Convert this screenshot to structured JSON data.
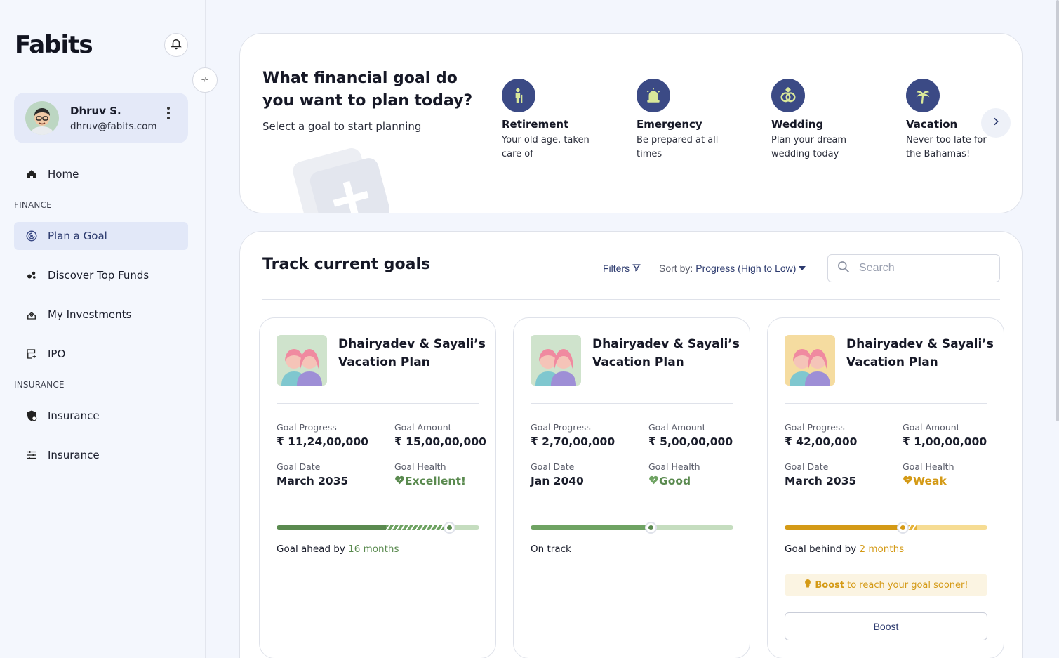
{
  "brand": {
    "logo": "Fabits"
  },
  "user": {
    "name": "Dhruv S.",
    "email": "dhruv@fabits.com"
  },
  "nav": {
    "home": "Home",
    "finance_label": "FINANCE",
    "plan_goal": "Plan a Goal",
    "discover": "Discover Top Funds",
    "investments": "My Investments",
    "ipo": "IPO",
    "insurance_label": "INSURANCE",
    "insurance1": "Insurance",
    "insurance2": "Insurance"
  },
  "banner": {
    "title": "What financial goal do you want to plan today?",
    "subtitle": "Select a goal to start planning",
    "options": [
      {
        "name": "Retirement",
        "desc": "Your old age, taken care of",
        "icon": "elder-icon"
      },
      {
        "name": "Emergency",
        "desc": "Be prepared at all times",
        "icon": "siren-icon"
      },
      {
        "name": "Wedding",
        "desc": "Plan your dream wedding today",
        "icon": "rings-icon"
      },
      {
        "name": "Vacation",
        "desc": "Never too late for the Bahamas!",
        "icon": "palm-tree-icon"
      }
    ]
  },
  "track": {
    "title": "Track current goals",
    "filters": "Filters",
    "sort_prefix": "Sort by:",
    "sort_value": "Progress (High to Low)",
    "search_placeholder": "Search"
  },
  "labels": {
    "progress": "Goal Progress",
    "amount": "Goal Amount",
    "date": "Goal Date",
    "health": "Goal Health"
  },
  "goals": [
    {
      "title": "Dhairyadev & Sayali’s Vacation Plan",
      "progress": "₹ 11,24,00,000",
      "amount": "₹ 15,00,00,000",
      "date": "March 2035",
      "health": "Excellent!",
      "status_prefix": "Goal ahead by ",
      "status_highlight": "16 months",
      "progress_fraction": 0.54,
      "expected_fraction": 0.85,
      "thumb_color": "#cfe3cc"
    },
    {
      "title": "Dhairyadev & Sayali’s Vacation Plan",
      "progress": "₹ 2,70,00,000",
      "amount": "₹ 5,00,00,000",
      "date": "Jan 2040",
      "health": "Good",
      "status_prefix": "On track",
      "status_highlight": "",
      "progress_fraction": 0.59,
      "expected_fraction": 0.59,
      "thumb_color": "#cfe3cc"
    },
    {
      "title": "Dhairyadev & Sayali’s Vacation Plan",
      "progress": "₹ 42,00,000",
      "amount": "₹ 1,00,00,000",
      "date": "March 2035",
      "health": "Weak",
      "status_prefix": "Goal behind by ",
      "status_highlight": "2 months",
      "progress_fraction": 0.58,
      "expected_fraction": 0.65,
      "thumb_color": "#f5dca0",
      "boost_tip_bold": "Boost",
      "boost_tip_rest": " to reach your goal sooner!",
      "boost_button": "Boost"
    }
  ],
  "colors": {
    "accent": "#3b4a85",
    "green_dark": "#5a8a4f",
    "green_light": "#c5ddbf",
    "green_mid": "#6fa363",
    "yellow": "#d49a16",
    "yellow_light": "#f6dc93"
  }
}
